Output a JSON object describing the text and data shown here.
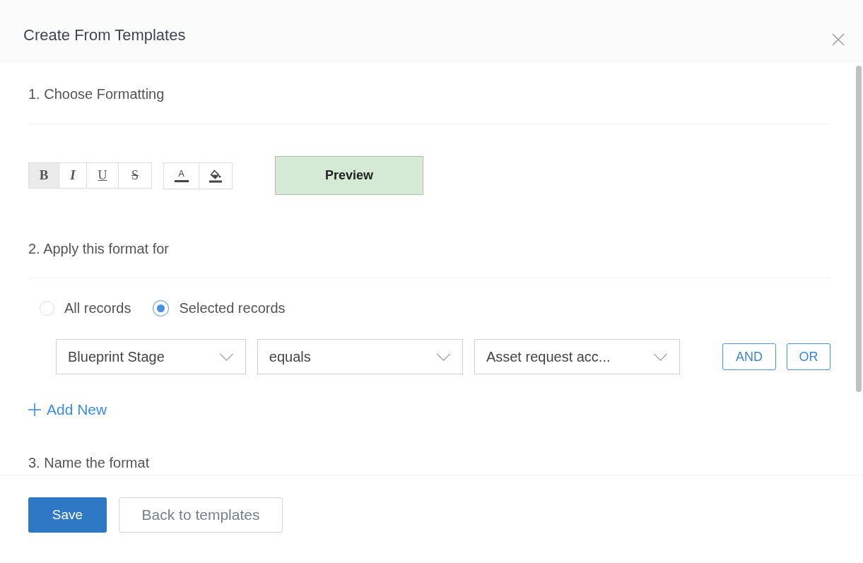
{
  "dialog": {
    "title": "Create From Templates"
  },
  "formatting": {
    "heading": "1. Choose Formatting",
    "tool_groups": [
      {
        "tools": [
          {
            "kind": "bold",
            "label": "B",
            "selected": true
          },
          {
            "kind": "italic",
            "label": "I",
            "selected": false
          },
          {
            "kind": "underline",
            "label": "U",
            "selected": false
          },
          {
            "kind": "strikethrough",
            "label": "S",
            "selected": false
          }
        ]
      },
      {
        "tools": [
          {
            "kind": "text_color",
            "label": "A",
            "selected": false
          },
          {
            "kind": "fill_color",
            "selected": false
          }
        ]
      }
    ],
    "preview": {
      "label": "Preview"
    }
  },
  "apply": {
    "heading": "2. Apply this format for",
    "options": [
      {
        "label": "All records",
        "selected": false
      },
      {
        "label": "Selected records",
        "selected": true
      }
    ],
    "conditions": [
      {
        "field": "Blueprint Stage",
        "operator": "equals",
        "value": "Asset request acc..."
      }
    ],
    "connectors": [
      "AND",
      "OR"
    ],
    "add_new": {
      "label": "Add New"
    }
  },
  "name": {
    "heading": "3. Name the format"
  },
  "footer": {
    "buttons": [
      {
        "kind": "primary",
        "label": "Save"
      },
      {
        "kind": "secondary",
        "label": "Back to templates"
      }
    ]
  }
}
